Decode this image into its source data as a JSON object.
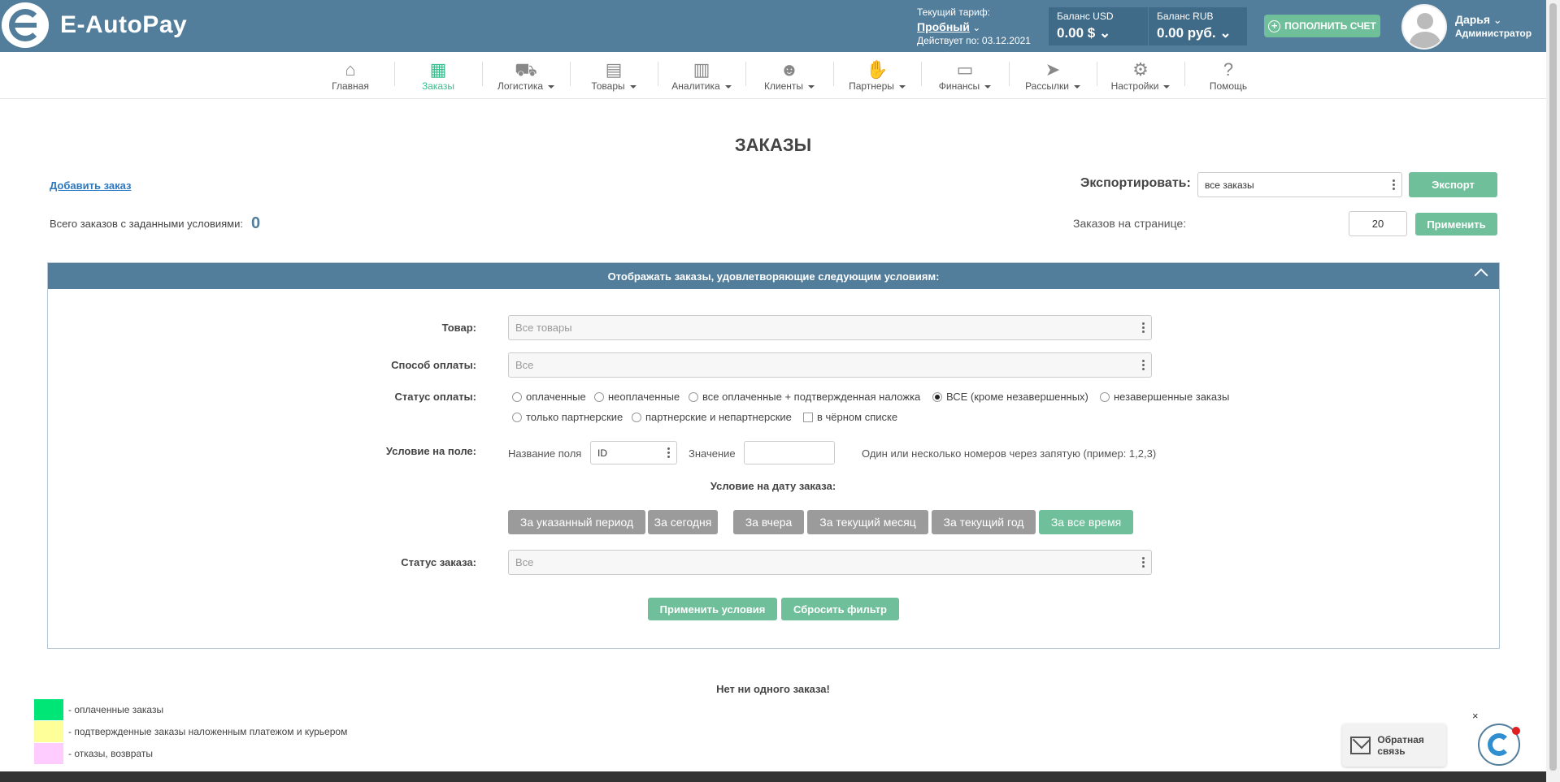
{
  "header": {
    "logo_text": "E-AutoPay",
    "tariff_label": "Текущий тариф:",
    "tariff_plan": "Пробный",
    "tariff_valid": "Действует по: 03.12.2021",
    "balance_usd_label": "Баланс USD",
    "balance_usd_value": "0.00 $",
    "balance_rub_label": "Баланс RUB",
    "balance_rub_value": "0.00 руб.",
    "topup_label": "ПОПОЛНИТЬ СЧЕТ",
    "user_name": "Дарья",
    "user_role": "Администратор"
  },
  "nav": [
    {
      "label": "Главная",
      "icon": "home-icon",
      "glyph": "⌂"
    },
    {
      "label": "Заказы",
      "icon": "boxes-icon",
      "glyph": "▦"
    },
    {
      "label": "Логистика",
      "icon": "truck-icon",
      "glyph": "⛟"
    },
    {
      "label": "Товары",
      "icon": "shelf-icon",
      "glyph": "▤"
    },
    {
      "label": "Аналитика",
      "icon": "chart-icon",
      "glyph": "▥"
    },
    {
      "label": "Клиенты",
      "icon": "users-icon",
      "glyph": "☻"
    },
    {
      "label": "Партнеры",
      "icon": "handshake-icon",
      "glyph": "✋"
    },
    {
      "label": "Финансы",
      "icon": "card-icon",
      "glyph": "▭"
    },
    {
      "label": "Рассылки",
      "icon": "paper-plane-icon",
      "glyph": "➤"
    },
    {
      "label": "Настройки",
      "icon": "gear-icon",
      "glyph": "⚙"
    },
    {
      "label": "Помощь",
      "icon": "question-icon",
      "glyph": "?"
    }
  ],
  "page": {
    "title": "ЗАКАЗЫ",
    "add_order": "Добавить заказ",
    "total_label": "Всего заказов с заданными условиями:",
    "total_value": "0",
    "export_label": "Экспортировать:",
    "export_select": "все заказы",
    "export_button": "Экспорт",
    "per_page_label": "Заказов на странице:",
    "per_page_value": "20",
    "apply_button": "Применить"
  },
  "filter": {
    "header": "Отображать заказы, удовлетворяющие следующим условиям:",
    "product_label": "Товар:",
    "product_placeholder": "Все товары",
    "payment_method_label": "Способ оплаты:",
    "payment_method_value": "Все",
    "payment_status_label": "Статус оплаты:",
    "payment_status_options": [
      "оплаченные",
      "неоплаченные",
      "все оплаченные + подтвержденная наложка",
      "ВСЕ (кроме незавершенных)",
      "незавершенные заказы",
      "только партнерские",
      "партнерские и непартнерские"
    ],
    "blacklist_label": "в чёрном списке",
    "field_condition_label": "Условие на поле:",
    "field_name_label": "Название поля",
    "field_name_value": "ID",
    "field_value_label": "Значение",
    "field_value": "",
    "field_hint": "Один или несколько номеров через запятую (пример: 1,2,3)",
    "date_condition_label": "Условие на дату заказа:",
    "date_buttons": [
      "За указанный период",
      "За сегодня",
      "За вчера",
      "За текущий месяц",
      "За текущий год",
      "За все время"
    ],
    "order_status_label": "Статус заказа:",
    "order_status_value": "Все",
    "apply_conditions": "Применить условия",
    "reset_filter": "Сбросить фильтр"
  },
  "results": {
    "empty_text": "Нет ни одного заказа!"
  },
  "legend": [
    {
      "color": "#00e676",
      "label": "- оплаченные заказы"
    },
    {
      "color": "#ffff99",
      "label": "- подтвержденные заказы наложенным платежом и курьером"
    },
    {
      "color": "#ffccff",
      "label": "- отказы, возвраты"
    }
  ],
  "feedback": {
    "label": "Обратная связь",
    "close": "×"
  },
  "colors": {
    "header_bg": "#527e9b",
    "accent_green": "#6fbf9a",
    "active_nav": "#34c08e"
  }
}
